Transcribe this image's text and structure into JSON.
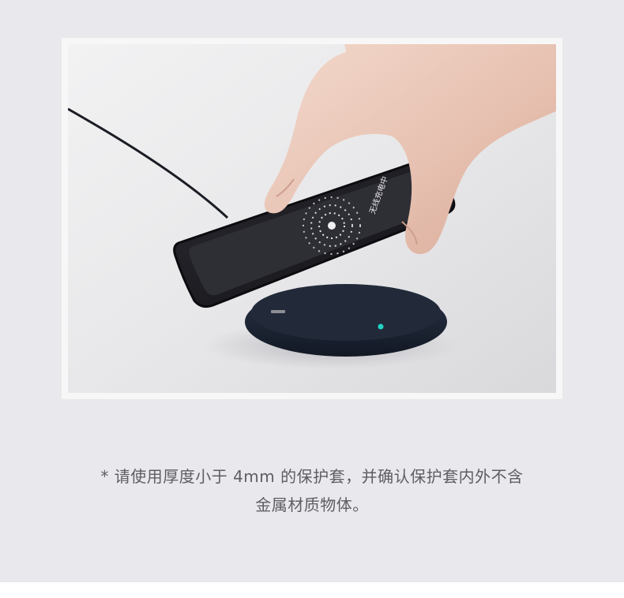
{
  "caption": {
    "line1": "* 请使用厚度小于 4mm 的保护套，并确认保护套内外不含",
    "line2": "金属材质物体。"
  },
  "phone_screen": {
    "status_text": "无线充电中"
  },
  "colors": {
    "page_background": "#e9e9ed",
    "frame_border": "#f7f7f8",
    "caption_text": "#5d5d62",
    "charger_body": "#1d2433",
    "indicator_light": "#22d3c6"
  }
}
